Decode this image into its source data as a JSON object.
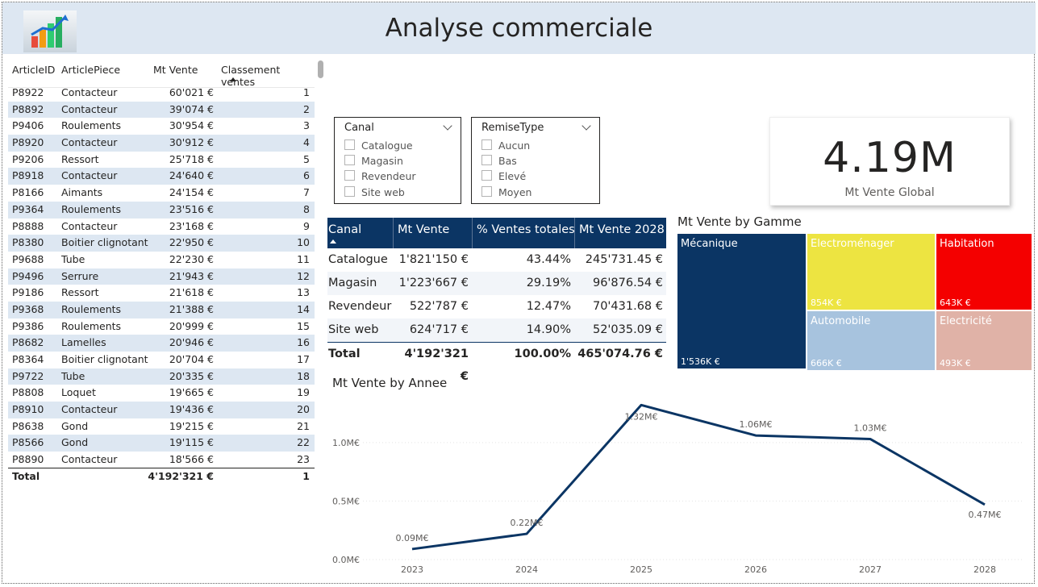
{
  "header": {
    "title": "Analyse commerciale",
    "logo": "bar-chart-growth-logo",
    "background": "#dde7f2"
  },
  "articles": {
    "columns": [
      "ArticleID",
      "ArticlePiece",
      "Mt Vente",
      "Classement ventes"
    ],
    "sorted_column": "Classement ventes",
    "rows": [
      {
        "id": "P8922",
        "piece": "Contacteur",
        "mt": "60'021 €",
        "rank": "1"
      },
      {
        "id": "P8892",
        "piece": "Contacteur",
        "mt": "39'074 €",
        "rank": "2"
      },
      {
        "id": "P9406",
        "piece": "Roulements",
        "mt": "30'954 €",
        "rank": "3"
      },
      {
        "id": "P8920",
        "piece": "Contacteur",
        "mt": "30'912 €",
        "rank": "4"
      },
      {
        "id": "P9206",
        "piece": "Ressort",
        "mt": "25'718 €",
        "rank": "5"
      },
      {
        "id": "P8918",
        "piece": "Contacteur",
        "mt": "24'640 €",
        "rank": "6"
      },
      {
        "id": "P8166",
        "piece": "Aimants",
        "mt": "24'154 €",
        "rank": "7"
      },
      {
        "id": "P9364",
        "piece": "Roulements",
        "mt": "23'516 €",
        "rank": "8"
      },
      {
        "id": "P8888",
        "piece": "Contacteur",
        "mt": "23'168 €",
        "rank": "9"
      },
      {
        "id": "P8380",
        "piece": "Boitier clignotant",
        "mt": "22'950 €",
        "rank": "10"
      },
      {
        "id": "P9688",
        "piece": "Tube",
        "mt": "22'230 €",
        "rank": "11"
      },
      {
        "id": "P9496",
        "piece": "Serrure",
        "mt": "21'943 €",
        "rank": "12"
      },
      {
        "id": "P9186",
        "piece": "Ressort",
        "mt": "21'618 €",
        "rank": "13"
      },
      {
        "id": "P9368",
        "piece": "Roulements",
        "mt": "21'388 €",
        "rank": "14"
      },
      {
        "id": "P9386",
        "piece": "Roulements",
        "mt": "20'999 €",
        "rank": "15"
      },
      {
        "id": "P8682",
        "piece": "Lamelles",
        "mt": "20'946 €",
        "rank": "16"
      },
      {
        "id": "P8364",
        "piece": "Boitier clignotant",
        "mt": "20'704 €",
        "rank": "17"
      },
      {
        "id": "P9722",
        "piece": "Tube",
        "mt": "20'335 €",
        "rank": "18"
      },
      {
        "id": "P8808",
        "piece": "Loquet",
        "mt": "19'665 €",
        "rank": "19"
      },
      {
        "id": "P8910",
        "piece": "Contacteur",
        "mt": "19'436 €",
        "rank": "20"
      },
      {
        "id": "P8638",
        "piece": "Gond",
        "mt": "19'215 €",
        "rank": "21"
      },
      {
        "id": "P8566",
        "piece": "Gond",
        "mt": "19'115 €",
        "rank": "22"
      },
      {
        "id": "P8890",
        "piece": "Contacteur",
        "mt": "18'566 €",
        "rank": "23"
      }
    ],
    "total": {
      "label": "Total",
      "mt": "4'192'321 €",
      "rank": "1"
    }
  },
  "slicers": [
    {
      "title": "Canal",
      "options": [
        "Catalogue",
        "Magasin",
        "Revendeur",
        "Site web"
      ]
    },
    {
      "title": "RemiseType",
      "options": [
        "Aucun",
        "Bas",
        "Elevé",
        "Moyen"
      ]
    }
  ],
  "kpi": {
    "value": "4.19M",
    "label": "Mt Vente Global"
  },
  "canal_table": {
    "columns": [
      "Canal",
      "Mt Vente",
      "% Ventes totales",
      "Mt Vente 2028"
    ],
    "rows": [
      {
        "canal": "Catalogue",
        "mt": "1'821'150 €",
        "pct": "43.44%",
        "mt2028": "245'731.45 €"
      },
      {
        "canal": "Magasin",
        "mt": "1'223'667 €",
        "pct": "29.19%",
        "mt2028": "96'876.54 €"
      },
      {
        "canal": "Revendeur",
        "mt": "522'787 €",
        "pct": "12.47%",
        "mt2028": "70'431.68 €"
      },
      {
        "canal": "Site web",
        "mt": "624'717 €",
        "pct": "14.90%",
        "mt2028": "52'035.09 €"
      }
    ],
    "total": {
      "canal": "Total",
      "mt": "4'192'321 €",
      "pct": "100.00%",
      "mt2028": "465'074.76 €"
    }
  },
  "treemap": {
    "title": "Mt Vente by Gamme",
    "tiles": [
      {
        "name": "Mécanique",
        "value": "1'536K €",
        "color": "#0b3564"
      },
      {
        "name": "Electroménager",
        "value": "854K €",
        "color": "#ede441"
      },
      {
        "name": "Habitation",
        "value": "643K €",
        "color": "#f40000"
      },
      {
        "name": "Automobile",
        "value": "666K €",
        "color": "#a7c3de"
      },
      {
        "name": "Electricité",
        "value": "493K €",
        "color": "#e0b2a7"
      }
    ]
  },
  "chart_data": {
    "type": "line",
    "title": "Mt Vente by Annee",
    "x": [
      "2023",
      "2024",
      "2025",
      "2026",
      "2027",
      "2028"
    ],
    "series": [
      {
        "values": [
          0.09,
          0.22,
          1.32,
          1.06,
          1.03,
          0.47
        ]
      }
    ],
    "data_labels": [
      "0.09M€",
      "0.22M€",
      "1.32M€",
      "1.06M€",
      "1.03M€",
      "0.47M€"
    ],
    "yticks": [
      "0.0M€",
      "0.5M€",
      "1.0M€"
    ],
    "ylim": [
      0,
      1.35
    ],
    "color": "#0b3564",
    "grid": true
  }
}
